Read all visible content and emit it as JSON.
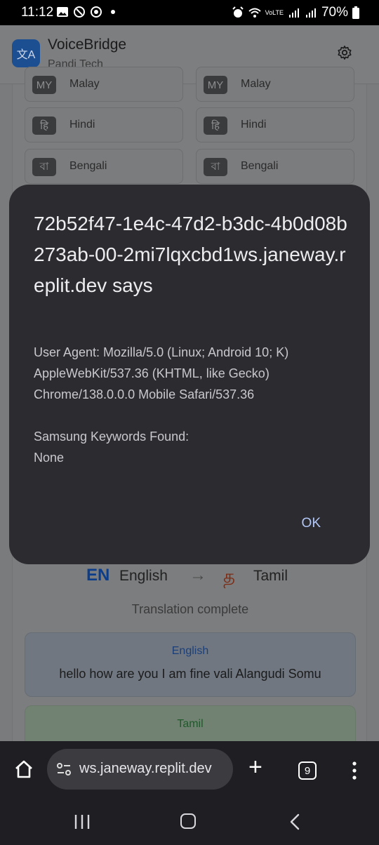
{
  "status_bar": {
    "time": "11:12",
    "battery": "70%",
    "network": "VoLTE"
  },
  "app": {
    "title": "VoiceBridge",
    "subtitle": "Pandi Tech",
    "brand_color": "#1a73e8"
  },
  "languages": [
    {
      "badge": "MY",
      "name": "Malay"
    },
    {
      "badge": "MY",
      "name": "Malay"
    },
    {
      "badge": "हि",
      "name": "Hindi"
    },
    {
      "badge": "हि",
      "name": "Hindi"
    },
    {
      "badge": "বা",
      "name": "Bengali"
    },
    {
      "badge": "বা",
      "name": "Bengali"
    }
  ],
  "direction": {
    "source_code": "EN",
    "source_name": "English",
    "arrow": "→",
    "target_glyph": "த",
    "target_name": "Tamil"
  },
  "translation_status": "Translation complete",
  "result": {
    "english_label": "English",
    "english_text": "hello how are you I am fine vali Alangudi Somu",
    "tamil_label": "Tamil"
  },
  "dialog": {
    "title": "72b52f47-1e4c-47d2-b3dc-4b0d08b273ab-00-2mi7lqxcbd1ws.janeway.replit.dev says",
    "user_agent": "User Agent: Mozilla/5.0 (Linux; Android 10; K) AppleWebKit/537.36 (KHTML, like Gecko) Chrome/138.0.0.0 Mobile Safari/537.36",
    "keywords_line1": "Samsung Keywords Found:",
    "keywords_line2": "None",
    "ok_label": "OK"
  },
  "browser": {
    "url": "ws.janeway.replit.dev",
    "tab_count": "9"
  }
}
